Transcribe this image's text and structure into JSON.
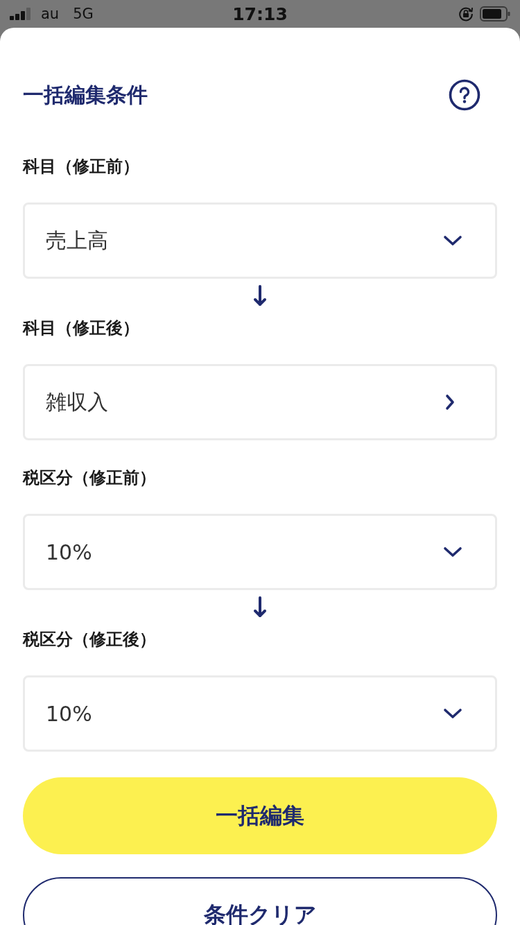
{
  "status_bar": {
    "carrier": "au",
    "network": "5G",
    "time": "17:13"
  },
  "sheet": {
    "title": "一括編集条件",
    "groups": [
      {
        "before": {
          "label": "科目（修正前）",
          "value": "売上高",
          "kind": "dropdown"
        },
        "after": {
          "label": "科目（修正後）",
          "value": "雑収入",
          "kind": "link"
        }
      },
      {
        "before": {
          "label": "税区分（修正前）",
          "value": "10%",
          "kind": "dropdown"
        },
        "after": {
          "label": "税区分（修正後）",
          "value": "10%",
          "kind": "dropdown"
        }
      }
    ],
    "buttons": [
      {
        "label": "一括編集",
        "kind": "primary"
      },
      {
        "label": "条件クリア",
        "kind": "secondary"
      }
    ]
  }
}
